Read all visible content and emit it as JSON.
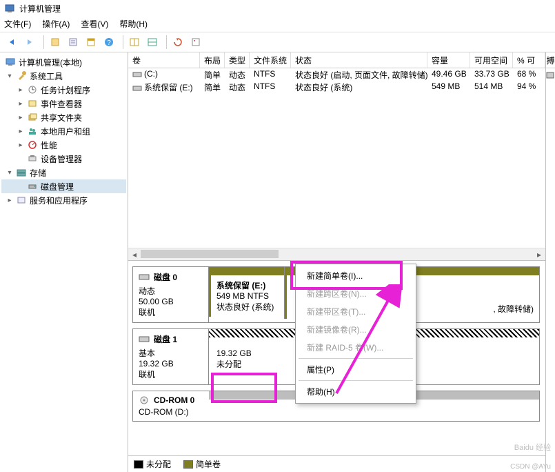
{
  "window": {
    "title": "计算机管理"
  },
  "menu": {
    "file": "文件(F)",
    "action": "操作(A)",
    "view": "查看(V)",
    "help": "帮助(H)"
  },
  "tree": {
    "root": "计算机管理(本地)",
    "system_tools": "系统工具",
    "task_scheduler": "任务计划程序",
    "event_viewer": "事件查看器",
    "shared_folders": "共享文件夹",
    "local_users": "本地用户和组",
    "performance": "性能",
    "device_mgr": "设备管理器",
    "storage": "存储",
    "disk_mgmt": "磁盘管理",
    "services_apps": "服务和应用程序"
  },
  "cols": {
    "volume": "卷",
    "layout": "布局",
    "type": "类型",
    "fs": "文件系统",
    "status": "状态",
    "capacity": "容量",
    "free": "可用空间",
    "pct": "% 可",
    "actions": "搏"
  },
  "vols": [
    {
      "name": "(C:)",
      "layout": "简单",
      "type": "动态",
      "fs": "NTFS",
      "status": "状态良好 (启动, 页面文件, 故障转储)",
      "capacity": "49.46 GB",
      "free": "33.73 GB",
      "pct": "68 %"
    },
    {
      "name": "系统保留 (E:)",
      "layout": "简单",
      "type": "动态",
      "fs": "NTFS",
      "status": "状态良好 (系统)",
      "capacity": "549 MB",
      "free": "514 MB",
      "pct": "94 %"
    }
  ],
  "disks": [
    {
      "title": "磁盘 0",
      "kind": "动态",
      "size": "50.00 GB",
      "state": "联机",
      "part_e": {
        "name": "系统保留  (E:)",
        "cap": "549 MB NTFS",
        "status": "状态良好 (系统)"
      },
      "part_c_status": ", 故障转储)"
    },
    {
      "title": "磁盘 1",
      "kind": "基本",
      "size": "19.32 GB",
      "state": "联机",
      "unalloc_size": "19.32 GB",
      "unalloc_label": "未分配"
    },
    {
      "title": "CD-ROM 0",
      "sub": "CD-ROM (D:)"
    }
  ],
  "ctx": {
    "new_simple": "新建简单卷(I)...",
    "new_span": "新建跨区卷(N)...",
    "new_stripe": "新建带区卷(T)...",
    "new_mirror": "新建镜像卷(R)...",
    "new_raid5": "新建 RAID-5 卷(W)...",
    "props": "属性(P)",
    "help": "帮助(H)"
  },
  "legend": {
    "unalloc": "未分配",
    "simple": "简单卷"
  },
  "watermark": "Baidu 经验",
  "csdn": "CSDN @AYu"
}
